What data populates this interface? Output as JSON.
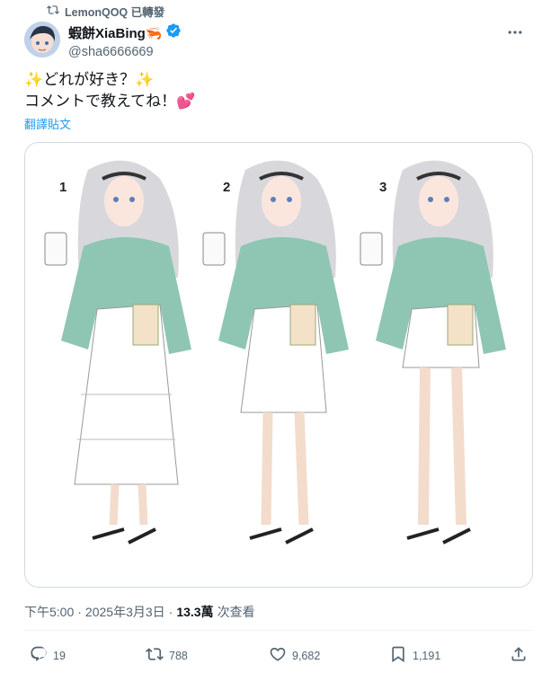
{
  "repost": {
    "icon": "retweet-icon",
    "text": "LemonQOQ 已轉發"
  },
  "author": {
    "name": "蝦餅XiaBing🦐",
    "handle": "@sha6666669",
    "verified": true,
    "verified_color": "#1d9bf0"
  },
  "tweet": {
    "lines": [
      "✨どれが好き？✨",
      "コメントで教えてね！💕"
    ],
    "translate_label": "翻譯貼文"
  },
  "media": {
    "labels": [
      "1",
      "2",
      "3"
    ],
    "description_icon": "illustration-image"
  },
  "meta": {
    "time": "下午5:00",
    "date": "2025年3月3日",
    "separator": "·",
    "views_count": "13.3萬",
    "views_label": "次查看"
  },
  "actions": {
    "reply_count": "19",
    "retweet_count": "788",
    "like_count": "9,682",
    "bookmark_count": "1,191"
  },
  "colors": {
    "text_secondary": "#536471",
    "accent": "#1d9bf0",
    "border": "#cfd9de"
  }
}
